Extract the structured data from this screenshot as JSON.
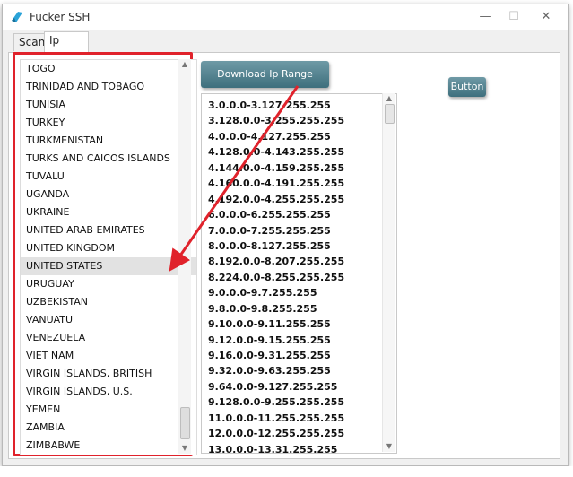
{
  "window": {
    "title": "Fucker SSH",
    "controls": {
      "minimize": "—",
      "maximize": "☐",
      "close": "✕"
    }
  },
  "tabs": [
    {
      "label": "Scan"
    },
    {
      "label": "Ip Range"
    }
  ],
  "buttons": {
    "download": "Download Ip Range",
    "generic": "Button"
  },
  "countries": [
    "TOGO",
    "TRINIDAD AND TOBAGO",
    "TUNISIA",
    "TURKEY",
    "TURKMENISTAN",
    "TURKS AND CAICOS ISLANDS",
    "TUVALU",
    "UGANDA",
    "UKRAINE",
    "UNITED ARAB EMIRATES",
    "UNITED KINGDOM",
    "UNITED STATES",
    "URUGUAY",
    "UZBEKISTAN",
    "VANUATU",
    "VENEZUELA",
    "VIET NAM",
    "VIRGIN ISLANDS, BRITISH",
    "VIRGIN ISLANDS, U.S.",
    "YEMEN",
    "ZAMBIA",
    "ZIMBABWE"
  ],
  "selected_country": "UNITED STATES",
  "ip_ranges": [
    "3.0.0.0-3.127.255.255",
    "3.128.0.0-3.255.255.255",
    "4.0.0.0-4.127.255.255",
    "4.128.0.0-4.143.255.255",
    "4.144.0.0-4.159.255.255",
    "4.160.0.0-4.191.255.255",
    "4.192.0.0-4.255.255.255",
    "6.0.0.0-6.255.255.255",
    "7.0.0.0-7.255.255.255",
    "8.0.0.0-8.127.255.255",
    "8.192.0.0-8.207.255.255",
    "8.224.0.0-8.255.255.255",
    "9.0.0.0-9.7.255.255",
    "9.8.0.0-9.8.255.255",
    "9.10.0.0-9.11.255.255",
    "9.12.0.0-9.15.255.255",
    "9.16.0.0-9.31.255.255",
    "9.32.0.0-9.63.255.255",
    "9.64.0.0-9.127.255.255",
    "9.128.0.0-9.255.255.255",
    "11.0.0.0-11.255.255.255",
    "12.0.0.0-12.255.255.255",
    "13.0.0.0-13.31.255.255"
  ],
  "colors": {
    "highlight": "#e0222b",
    "button": "#4f7e8b"
  }
}
